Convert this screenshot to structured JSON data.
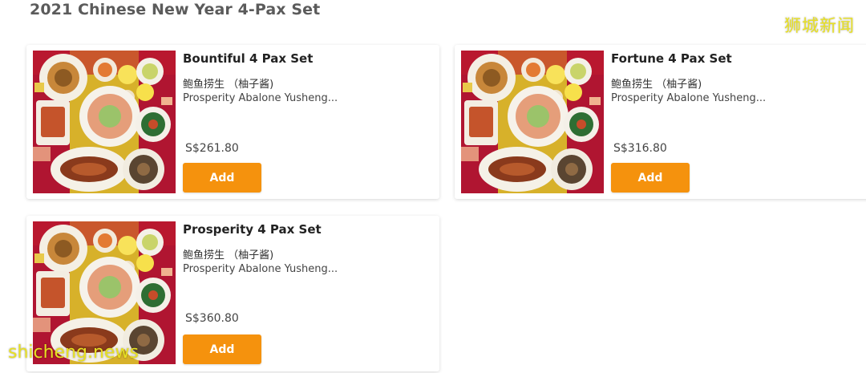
{
  "section": {
    "title": "2021 Chinese New Year 4-Pax Set"
  },
  "watermarks": {
    "top_right": "狮城新闻",
    "bottom_left": "shicheng.news"
  },
  "colors": {
    "button": "#f5920d",
    "watermark": "#e8e021"
  },
  "products": [
    {
      "name": "Bountiful 4 Pax Set",
      "dish_cn": "鲍鱼捞生 （柚子酱)",
      "dish_en": "Prosperity Abalone Yusheng...",
      "price": "S$261.80",
      "button_label": "Add",
      "image_icon": "food-platter-image"
    },
    {
      "name": "Fortune 4 Pax Set",
      "dish_cn": "鲍鱼捞生 （柚子酱)",
      "dish_en": "Prosperity Abalone Yusheng...",
      "price": "S$316.80",
      "button_label": "Add",
      "image_icon": "food-platter-image"
    },
    {
      "name": "Prosperity 4 Pax Set",
      "dish_cn": "鲍鱼捞生 （柚子酱)",
      "dish_en": "Prosperity Abalone Yusheng...",
      "price": "S$360.80",
      "button_label": "Add",
      "image_icon": "food-platter-image"
    }
  ]
}
